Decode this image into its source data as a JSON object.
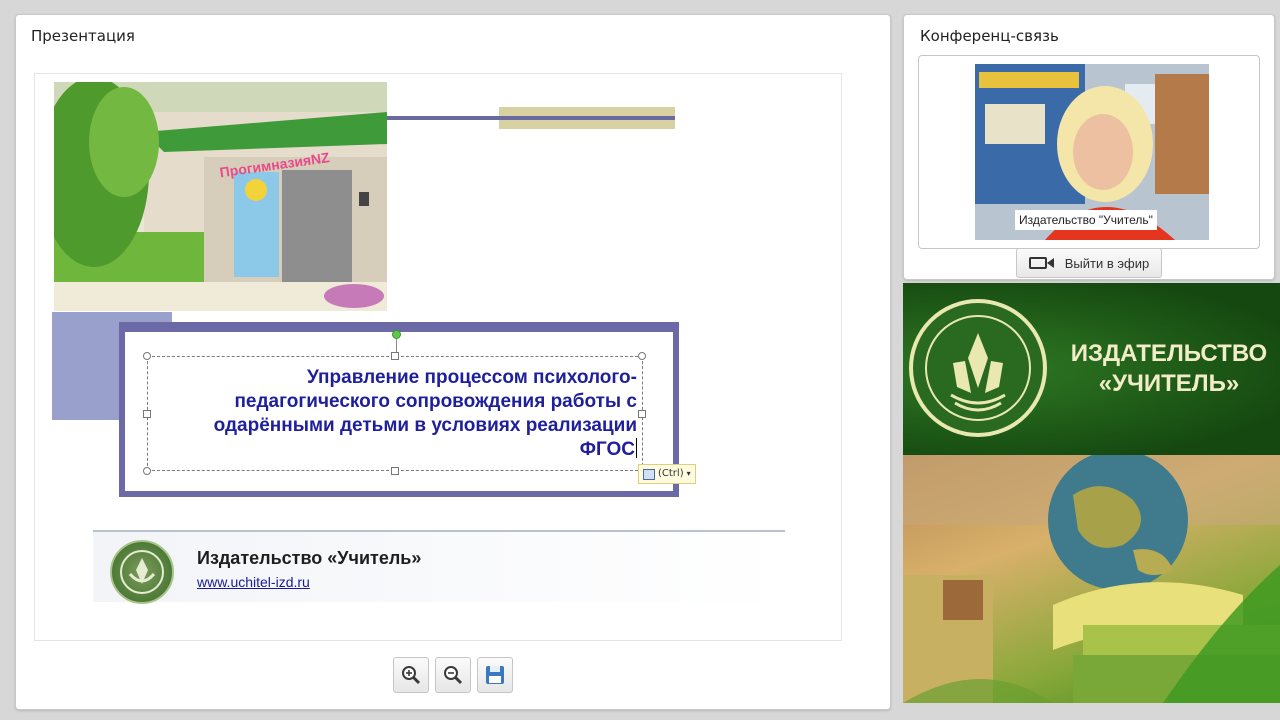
{
  "presentation": {
    "panel_title": "Презентация",
    "slide": {
      "title_text": "Управление процессом психолого-педагогического сопровождения работы с одарёнными детьми в условиях реализации ФГОС",
      "paste_tag": "(Ctrl)",
      "photo_sign": "ПрогимназияNZ",
      "footer_publisher": "Издательство «Учитель»",
      "footer_url": "www.uchitel-izd.ru"
    },
    "toolbar": {
      "zoom_in_icon": "zoom-in-icon",
      "zoom_out_icon": "zoom-out-icon",
      "save_icon": "floppy-disk-icon"
    }
  },
  "conference": {
    "panel_title": "Конференц-связь",
    "video_label": "Издательство \"Учитель\"",
    "go_live_label": "Выйти в эфир"
  },
  "branding": {
    "name_line1": "ИЗДАТЕЛЬСТВО",
    "name_line2": "«УЧИТЕЛЬ»"
  },
  "colors": {
    "title_blue": "#1f1f9c",
    "frame_purple": "#6c6aa6",
    "brand_green": "#1d5a16"
  }
}
